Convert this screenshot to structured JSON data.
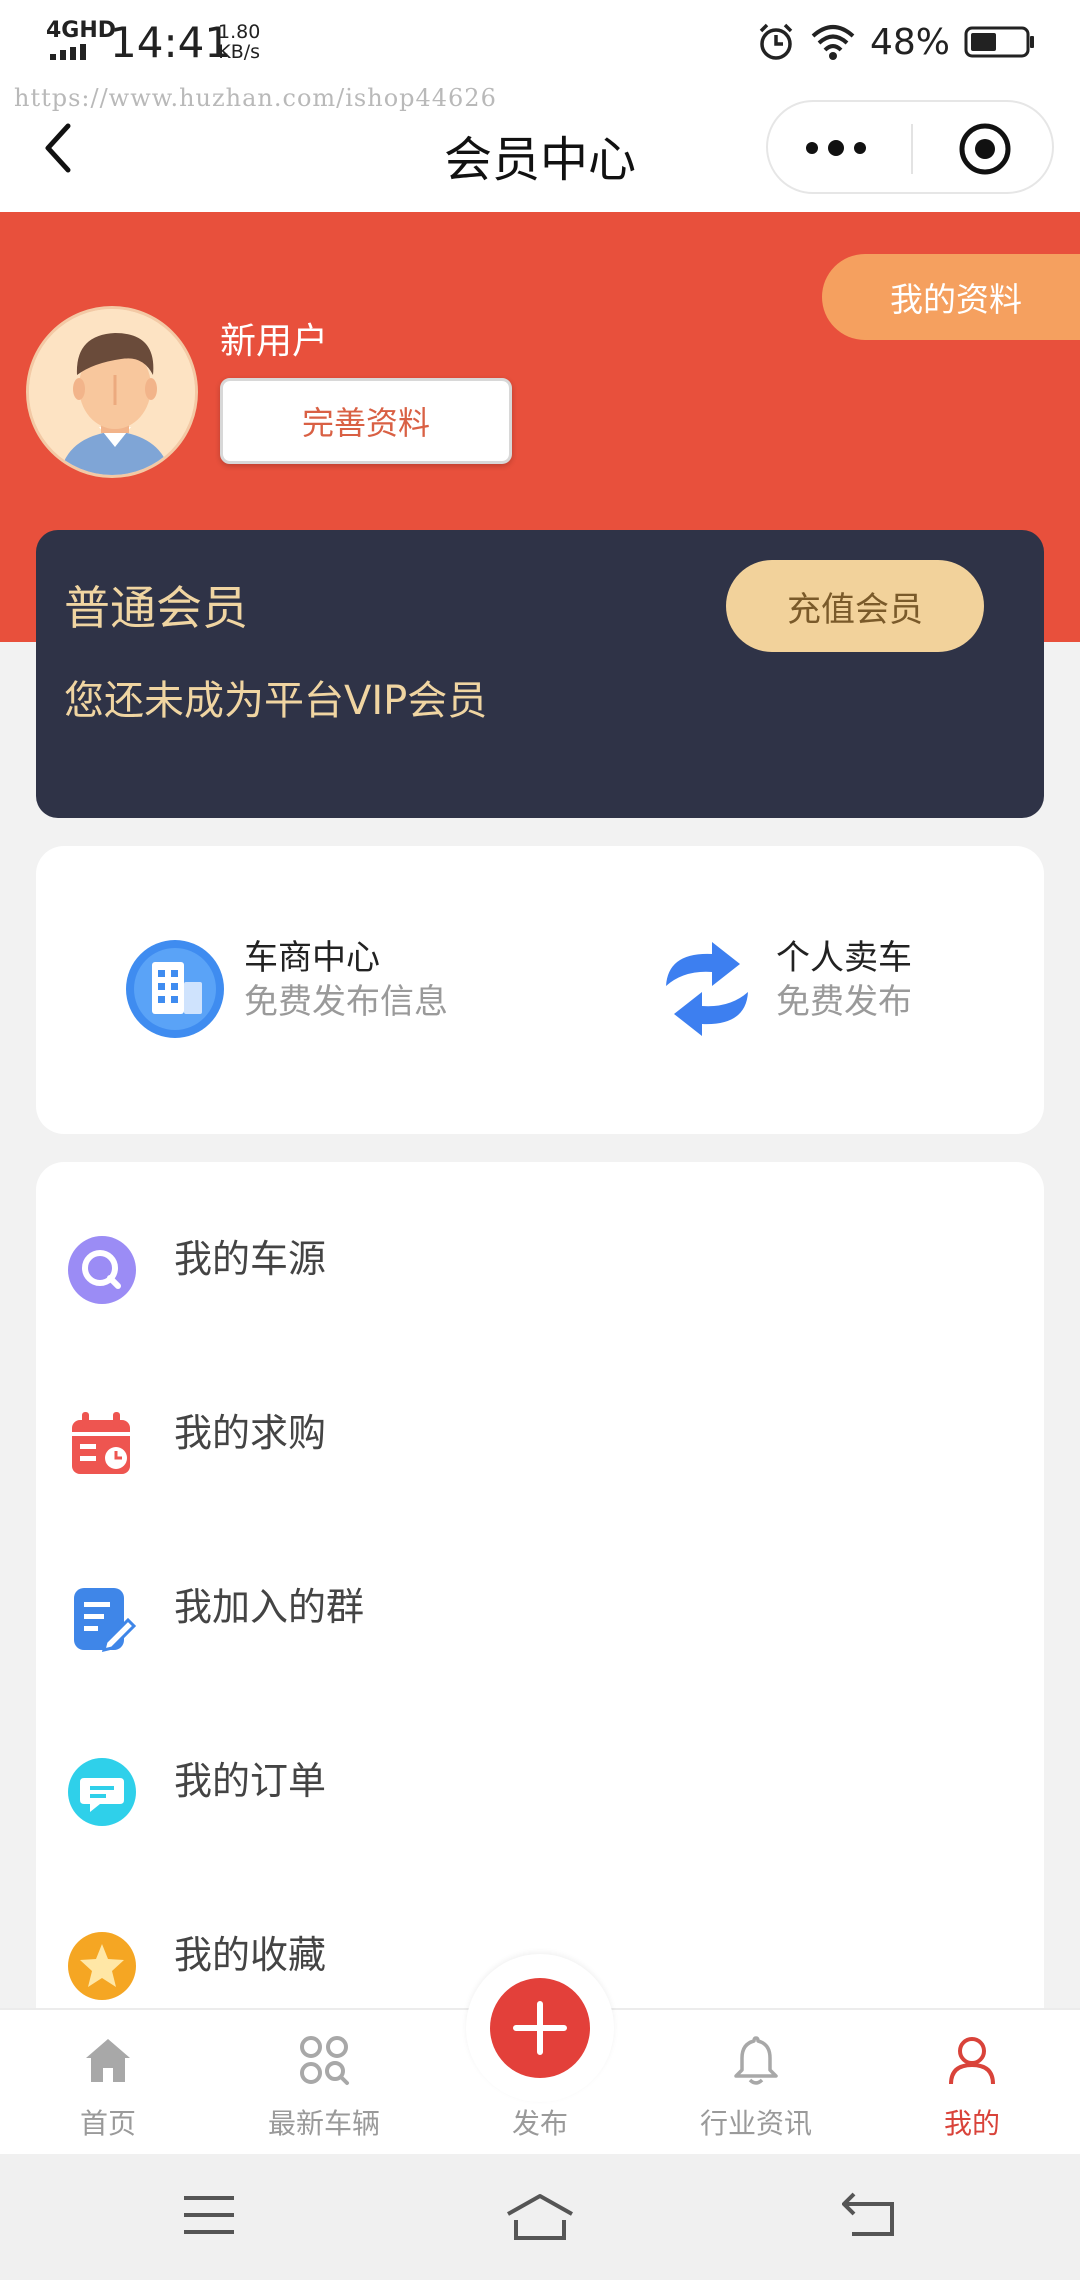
{
  "status_bar": {
    "network": "4GHD",
    "time": "14:41",
    "speed_value": "1.80",
    "speed_unit": "KB/s",
    "battery": "48%",
    "battery_level": 0.48
  },
  "watermark": "https://www.huzhan.com/ishop44626",
  "navbar": {
    "title": "会员中心"
  },
  "header": {
    "profile_button": "我的资料",
    "username": "新用户",
    "complete_button": "完善资料"
  },
  "member_card": {
    "title": "普通会员",
    "description": "您还未成为平台VIP会员",
    "recharge_button": "充值会员"
  },
  "services": [
    {
      "title": "车商中心",
      "subtitle": "免费发布信息",
      "icon": "building-icon"
    },
    {
      "title": "个人卖车",
      "subtitle": "免费发布",
      "icon": "exchange-arrows-icon"
    }
  ],
  "menu": [
    {
      "label": "我的车源",
      "icon": "search-icon"
    },
    {
      "label": "我的求购",
      "icon": "calendar-icon"
    },
    {
      "label": "我加入的群",
      "icon": "document-edit-icon"
    },
    {
      "label": "我的订单",
      "icon": "chat-icon"
    },
    {
      "label": "我的收藏",
      "icon": "star-icon"
    }
  ],
  "tabs": [
    {
      "label": "首页",
      "icon": "home-icon"
    },
    {
      "label": "最新车辆",
      "icon": "grid-icon"
    },
    {
      "label": "发布",
      "icon": "plus-icon"
    },
    {
      "label": "行业资讯",
      "icon": "bell-icon"
    },
    {
      "label": "我的",
      "icon": "user-icon",
      "active": true
    }
  ],
  "colors": {
    "header_red": "#e8503c",
    "accent_orange": "#f5a05f",
    "card_dark": "#2f3347",
    "gold_text": "#f0d5a2",
    "active_tab": "#d9433a"
  }
}
